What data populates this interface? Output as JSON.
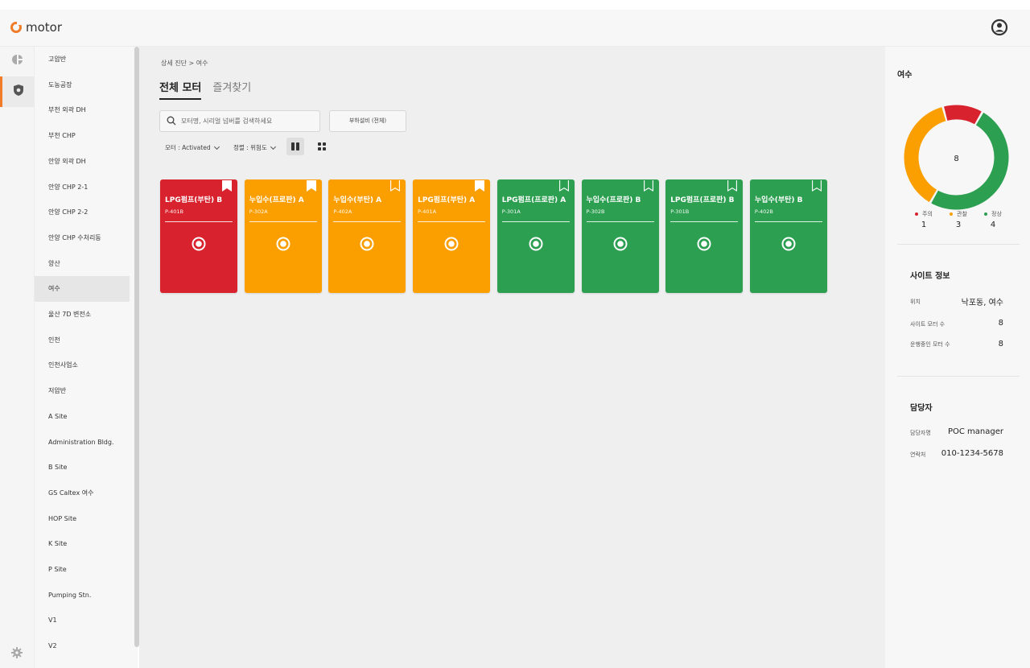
{
  "app": {
    "logo_text": "motor"
  },
  "colors": {
    "accent": "#f07c2a",
    "danger": "#d8232f",
    "warning": "#fb9e00",
    "normal": "#2c9f51"
  },
  "sidebar": {
    "items": [
      {
        "label": "고압반"
      },
      {
        "label": "도농공장"
      },
      {
        "label": "부천 외곽 DH"
      },
      {
        "label": "부천 CHP"
      },
      {
        "label": "안양 외곽 DH"
      },
      {
        "label": "안양 CHP 2-1"
      },
      {
        "label": "안양 CHP 2-2"
      },
      {
        "label": "안양 CHP 수처리동"
      },
      {
        "label": "양산"
      },
      {
        "label": "여수"
      },
      {
        "label": "울산 7D 변전소"
      },
      {
        "label": "인천"
      },
      {
        "label": "인천사업소"
      },
      {
        "label": "저압반"
      },
      {
        "label": "A Site"
      },
      {
        "label": "Administration Bldg."
      },
      {
        "label": "B Site"
      },
      {
        "label": "GS Caltex 여수"
      },
      {
        "label": "HOP Site"
      },
      {
        "label": "K Site"
      },
      {
        "label": "P Site"
      },
      {
        "label": "Pumping Stn."
      },
      {
        "label": "V1"
      },
      {
        "label": "V2"
      }
    ],
    "selected": "여수"
  },
  "main": {
    "breadcrumb": "상세 진단 > 여수",
    "tabs": [
      {
        "label": "전체 모터",
        "active": true
      },
      {
        "label": "즐겨찾기",
        "active": false
      }
    ],
    "search_placeholder": "모터명, 시리얼 넘버를 검색하세요",
    "filter_button": "부하설비 (전체)",
    "motor_filter": "모터 : Activated",
    "sort_filter": "정렬 : 위험도"
  },
  "motors": [
    {
      "name": "LPG펌프(부탄) B",
      "code": "P-401B",
      "status": "danger",
      "bookmarked": true
    },
    {
      "name": "누입수(프로판) A",
      "code": "P-302A",
      "status": "warning",
      "bookmarked": true
    },
    {
      "name": "누입수(부탄) A",
      "code": "P-402A",
      "status": "warning",
      "bookmarked": false
    },
    {
      "name": "LPG펌프(부탄) A",
      "code": "P-401A",
      "status": "warning",
      "bookmarked": true
    },
    {
      "name": "LPG펌프(프로판) A",
      "code": "P-301A",
      "status": "normal",
      "bookmarked": false
    },
    {
      "name": "누입수(프로판) B",
      "code": "P-302B",
      "status": "normal",
      "bookmarked": false
    },
    {
      "name": "LPG펌프(프로판) B",
      "code": "P-301B",
      "status": "normal",
      "bookmarked": false
    },
    {
      "name": "누입수(부탄) B",
      "code": "P-402B",
      "status": "normal",
      "bookmarked": false
    }
  ],
  "right_panel": {
    "site_title": "여수",
    "total": "8",
    "legend": [
      {
        "label": "주의",
        "value": "1",
        "color": "#d8232f"
      },
      {
        "label": "관찰",
        "value": "3",
        "color": "#fb9e00"
      },
      {
        "label": "정상",
        "value": "4",
        "color": "#2c9f51"
      }
    ],
    "site_info": {
      "title": "사이트 정보",
      "location_label": "위치",
      "location_value": "낙포동, 여수",
      "motor_count_label": "사이트 모터 수",
      "motor_count_value": "8",
      "running_label": "운행중인 모터 수",
      "running_value": "8"
    },
    "manager": {
      "title": "담당자",
      "name_label": "담당자명",
      "name_value": "POC manager",
      "contact_label": "연락처",
      "contact_value": "010-1234-5678"
    }
  }
}
